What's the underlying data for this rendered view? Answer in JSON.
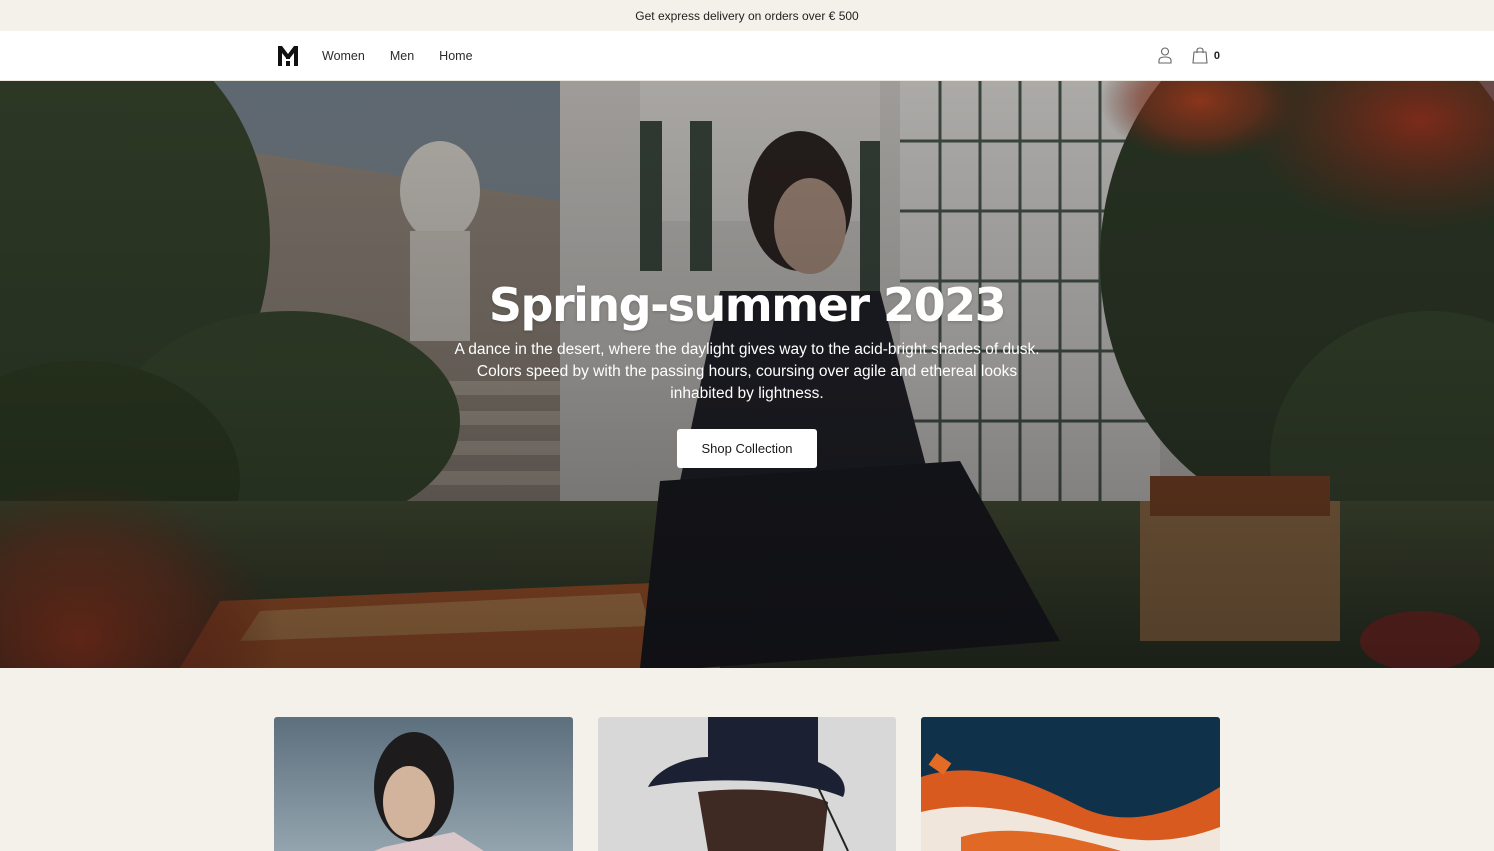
{
  "announcement": {
    "text": "Get express delivery on orders over € 500"
  },
  "header": {
    "logo": "brand-logo-icon",
    "nav": [
      {
        "label": "Women"
      },
      {
        "label": "Men"
      },
      {
        "label": "Home"
      }
    ],
    "account_icon": "user-icon",
    "cart_icon": "shopping-bag-icon",
    "cart_count": "0"
  },
  "hero": {
    "title": "Spring-summer 2023",
    "description": "A dance in the desert, where the daylight gives way to the acid-bright shades of dusk. Colors speed by with the passing hours, coursing over agile and ethereal looks inhabited by lightness.",
    "cta_label": "Shop Collection"
  },
  "collections": [
    {
      "image": "woman-portrait-photo"
    },
    {
      "image": "man-bucket-hat-photo"
    },
    {
      "image": "orange-blanket-photo"
    }
  ],
  "colors": {
    "background": "#f4f0ea",
    "header_bg": "#ffffff",
    "text": "#222222",
    "button_bg": "#ffffff"
  }
}
